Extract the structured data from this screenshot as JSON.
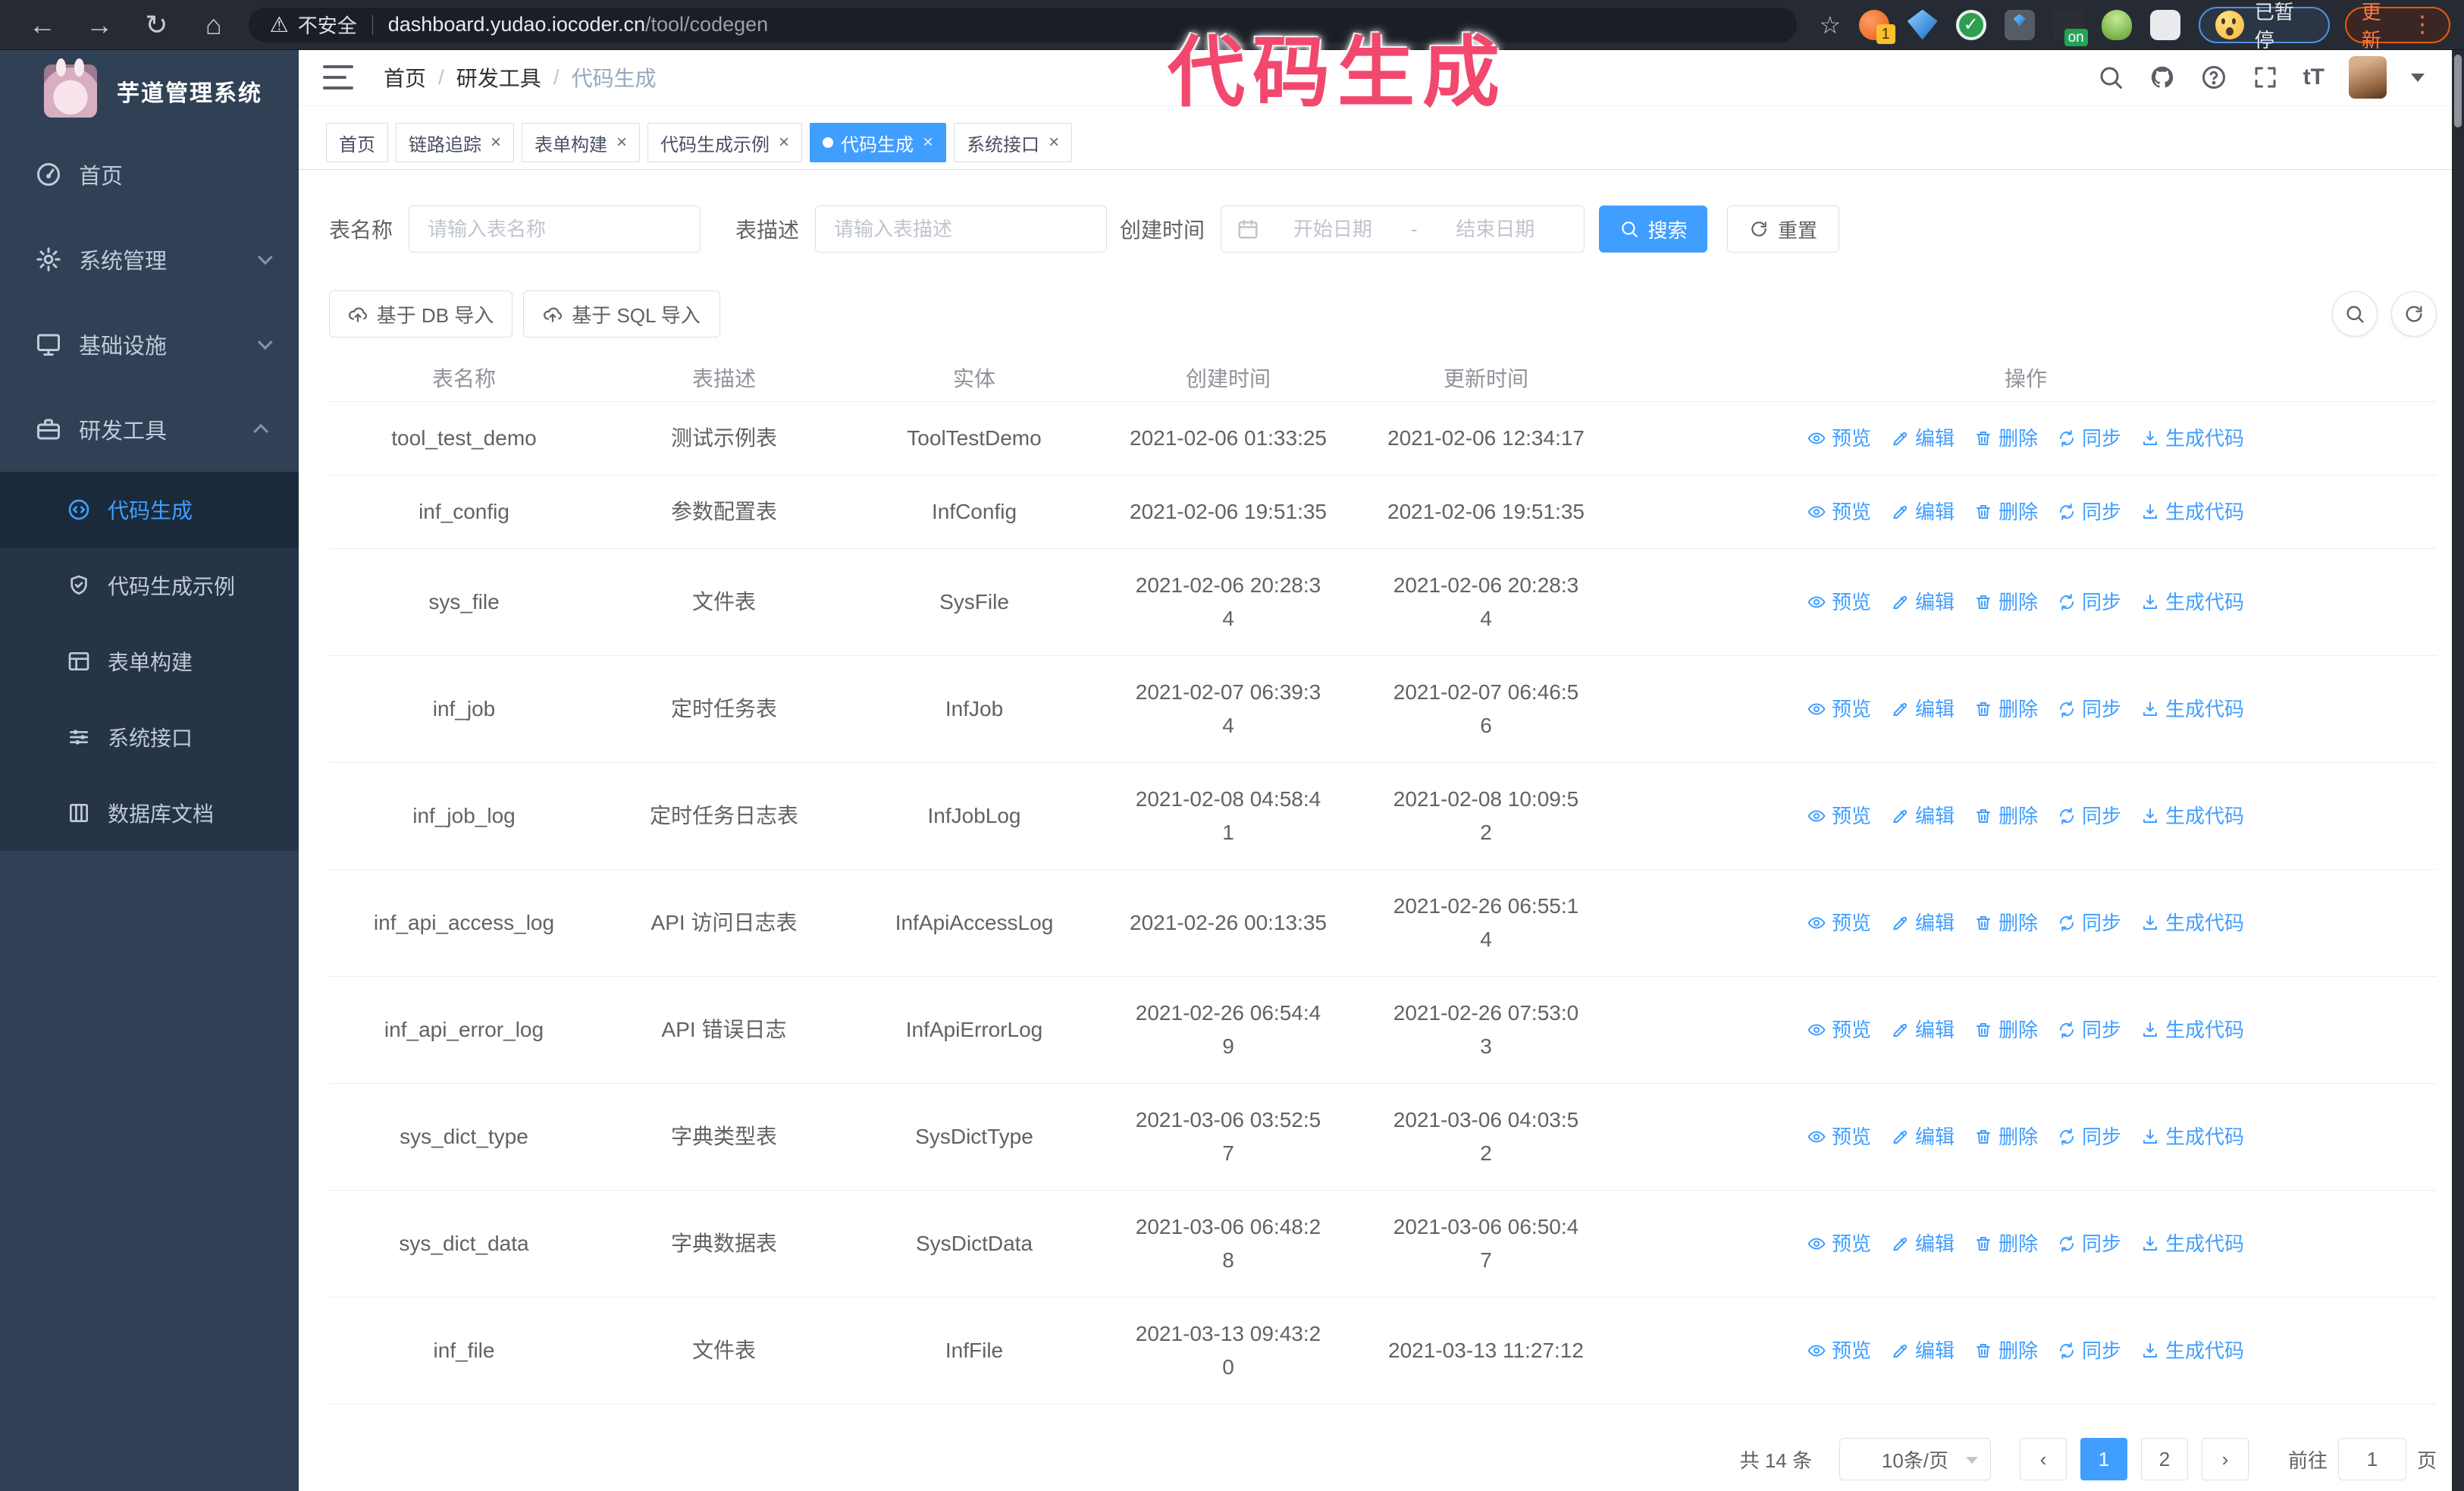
{
  "annotation": {
    "text": "代码生成",
    "color": "#f2486d"
  },
  "browser": {
    "not_secure": "不安全",
    "url_host": "dashboard.yudao.iocoder.cn",
    "url_path": "/tool/codegen",
    "ext_badge_count": "1",
    "ext_badge_on": "on",
    "paused_badge": "已暂停",
    "update_badge": "更新"
  },
  "sidebar": {
    "title": "芋道管理系统",
    "items": [
      {
        "label": "首页",
        "icon": "gauge",
        "chevron": ""
      },
      {
        "label": "系统管理",
        "icon": "gear",
        "chevron": "down"
      },
      {
        "label": "基础设施",
        "icon": "monitor",
        "chevron": "down"
      },
      {
        "label": "研发工具",
        "icon": "briefcase",
        "chevron": "up"
      }
    ],
    "submenu": [
      {
        "label": "代码生成",
        "icon": "code",
        "state": "active"
      },
      {
        "label": "代码生成示例",
        "icon": "shield",
        "state": ""
      },
      {
        "label": "表单构建",
        "icon": "form",
        "state": ""
      },
      {
        "label": "系统接口",
        "icon": "sliders",
        "state": ""
      },
      {
        "label": "数据库文档",
        "icon": "columns",
        "state": ""
      }
    ]
  },
  "header": {
    "breadcrumb": [
      {
        "label": "首页",
        "sep": "/",
        "state": ""
      },
      {
        "label": "研发工具",
        "sep": "/",
        "state": ""
      },
      {
        "label": "代码生成",
        "sep": "",
        "state": "current"
      }
    ]
  },
  "tabs": [
    {
      "label": "首页",
      "close": "",
      "state": ""
    },
    {
      "label": "链路追踪",
      "close": "×",
      "state": ""
    },
    {
      "label": "表单构建",
      "close": "×",
      "state": ""
    },
    {
      "label": "代码生成示例",
      "close": "×",
      "state": ""
    },
    {
      "label": "代码生成",
      "close": "×",
      "state": "active"
    },
    {
      "label": "系统接口",
      "close": "×",
      "state": ""
    }
  ],
  "filters": {
    "name_label": "表名称",
    "name_placeholder": "请输入表名称",
    "desc_label": "表描述",
    "desc_placeholder": "请输入表描述",
    "time_label": "创建时间",
    "date_start_placeholder": "开始日期",
    "date_separator": "-",
    "date_end_placeholder": "结束日期",
    "search_label": "搜索",
    "reset_label": "重置"
  },
  "toolbar": {
    "import_db": "基于 DB 导入",
    "import_sql": "基于 SQL 导入"
  },
  "table": {
    "columns": [
      "表名称",
      "表描述",
      "实体",
      "创建时间",
      "更新时间",
      "操作"
    ],
    "actions": [
      "预览",
      "编辑",
      "删除",
      "同步",
      "生成代码"
    ],
    "rows": [
      {
        "name": "tool_test_demo",
        "desc": "测试示例表",
        "entity": "ToolTestDemo",
        "created": "2021-02-06 01:33:25",
        "updated": "2021-02-06 12:34:17"
      },
      {
        "name": "inf_config",
        "desc": "参数配置表",
        "entity": "InfConfig",
        "created": "2021-02-06 19:51:35",
        "updated": "2021-02-06 19:51:35"
      },
      {
        "name": "sys_file",
        "desc": "文件表",
        "entity": "SysFile",
        "created": "2021-02-06 20:28:3\n4",
        "updated": "2021-02-06 20:28:3\n4"
      },
      {
        "name": "inf_job",
        "desc": "定时任务表",
        "entity": "InfJob",
        "created": "2021-02-07 06:39:3\n4",
        "updated": "2021-02-07 06:46:5\n6"
      },
      {
        "name": "inf_job_log",
        "desc": "定时任务日志表",
        "entity": "InfJobLog",
        "created": "2021-02-08 04:58:4\n1",
        "updated": "2021-02-08 10:09:5\n2"
      },
      {
        "name": "inf_api_access_log",
        "desc": "API 访问日志表",
        "entity": "InfApiAccessLog",
        "created": "2021-02-26 00:13:35",
        "updated": "2021-02-26 06:55:1\n4"
      },
      {
        "name": "inf_api_error_log",
        "desc": "API 错误日志",
        "entity": "InfApiErrorLog",
        "created": "2021-02-26 06:54:4\n9",
        "updated": "2021-02-26 07:53:0\n3"
      },
      {
        "name": "sys_dict_type",
        "desc": "字典类型表",
        "entity": "SysDictType",
        "created": "2021-03-06 03:52:5\n7",
        "updated": "2021-03-06 04:03:5\n2"
      },
      {
        "name": "sys_dict_data",
        "desc": "字典数据表",
        "entity": "SysDictData",
        "created": "2021-03-06 06:48:2\n8",
        "updated": "2021-03-06 06:50:4\n7"
      },
      {
        "name": "inf_file",
        "desc": "文件表",
        "entity": "InfFile",
        "created": "2021-03-13 09:43:2\n0",
        "updated": "2021-03-13 11:27:12"
      }
    ]
  },
  "pagination": {
    "total": "共 14 条",
    "page_size": "10条/页",
    "prev": "‹",
    "next": "›",
    "pages": [
      {
        "label": "1",
        "state": "active"
      },
      {
        "label": "2",
        "state": ""
      }
    ],
    "goto_label": "前往",
    "goto_value": "1",
    "goto_unit": "页"
  },
  "colors": {
    "primary": "#409eff",
    "sidebar_bg": "#304156",
    "annotation": "#f2486d"
  }
}
